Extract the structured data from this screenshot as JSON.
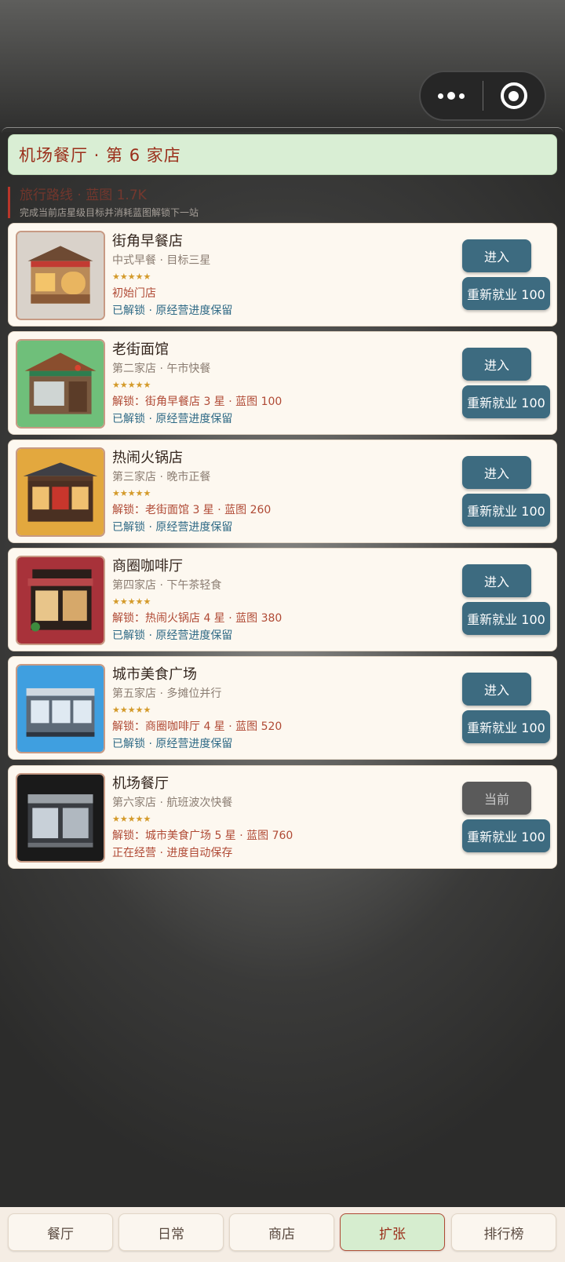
{
  "header": {
    "title": "机场餐厅 · 第 6 家店",
    "route_text": "旅行路线 · 蓝图 1.7K",
    "route_sub": "完成当前店星级目标并消耗蓝图解锁下一站"
  },
  "stores": [
    {
      "name": "街角早餐店",
      "sub": "中式早餐 · 目标三星",
      "stars": "★★★★★",
      "unlock": "初始门店",
      "status": "已解锁 · 原经营进度保留",
      "enter": "进入",
      "rehire": "重新就业 100",
      "thumb_bg": "#d9d2ca",
      "icon": "breakfast-shop-icon"
    },
    {
      "name": "老街面馆",
      "sub": "第二家店 · 午市快餐",
      "stars": "★★★★★",
      "unlock": "解锁：街角早餐店 3 星 · 蓝图 100",
      "status": "已解锁 · 原经营进度保留",
      "enter": "进入",
      "rehire": "重新就业 100",
      "thumb_bg": "#6fbf7a",
      "icon": "noodle-house-icon"
    },
    {
      "name": "热闹火锅店",
      "sub": "第三家店 · 晚市正餐",
      "stars": "★★★★★",
      "unlock": "解锁：老街面馆 3 星 · 蓝图 260",
      "status": "已解锁 · 原经营进度保留",
      "enter": "进入",
      "rehire": "重新就业 100",
      "thumb_bg": "#e3a83e",
      "icon": "hotpot-shop-icon"
    },
    {
      "name": "商圈咖啡厅",
      "sub": "第四家店 · 下午茶轻食",
      "stars": "★★★★★",
      "unlock": "解锁：热闹火锅店 4 星 · 蓝图 380",
      "status": "已解锁 · 原经营进度保留",
      "enter": "进入",
      "rehire": "重新就业 100",
      "thumb_bg": "#a8323a",
      "icon": "cafe-icon"
    },
    {
      "name": "城市美食广场",
      "sub": "第五家店 · 多摊位并行",
      "stars": "★★★★★",
      "unlock": "解锁：商圈咖啡厅 4 星 · 蓝图 520",
      "status": "已解锁 · 原经营进度保留",
      "enter": "进入",
      "rehire": "重新就业 100",
      "thumb_bg": "#3f9fe0",
      "icon": "food-court-icon"
    },
    {
      "name": "机场餐厅",
      "sub": "第六家店 · 航班波次快餐",
      "stars": "★★★★★",
      "unlock": "解锁：城市美食广场 5 星 · 蓝图 760",
      "status": "正在经营 · 进度自动保存",
      "enter": "当前",
      "rehire": "重新就业 100",
      "thumb_bg": "#1a1a1a",
      "icon": "airport-restaurant-icon"
    }
  ],
  "tabs": [
    {
      "label": "餐厅",
      "active": false
    },
    {
      "label": "日常",
      "active": false
    },
    {
      "label": "商店",
      "active": false
    },
    {
      "label": "扩张",
      "active": true
    },
    {
      "label": "排行榜",
      "active": false
    }
  ],
  "colors": {
    "accent_red": "#b04a35",
    "button_teal": "#3d6b80",
    "title_green": "#d9eed4",
    "card_bg": "#fdf8f0"
  }
}
